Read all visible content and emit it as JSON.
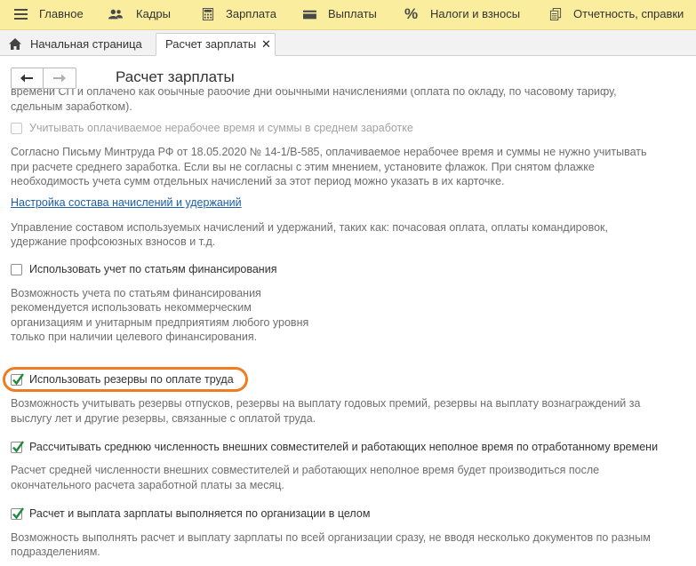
{
  "menu": {
    "items": [
      {
        "label": "Главное",
        "icon": "menu-hamburger-icon"
      },
      {
        "label": "Кадры",
        "icon": "people-icon"
      },
      {
        "label": "Зарплата",
        "icon": "calculator-icon"
      },
      {
        "label": "Выплаты",
        "icon": "wallet-icon"
      },
      {
        "label": "Налоги и взносы",
        "icon": "percent-icon"
      },
      {
        "label": "Отчетность, справки",
        "icon": "documents-icon"
      }
    ]
  },
  "tabs": {
    "home": "Начальная страница",
    "active": "Расчет зарплаты",
    "close_glyph": "✕"
  },
  "page": {
    "title": "Расчет зарплаты"
  },
  "content": {
    "cut_line_1": "времени СП и оплачено как обычные рабочие дни обычными начислениями (оплата по окладу, по часовому тарифу,",
    "cut_line_2": "сдельным заработком).",
    "nonworking_checkbox": {
      "label": "Учитывать оплачиваемое нерабочее время и суммы в среднем заработке",
      "checked": false,
      "disabled": true
    },
    "nonworking_desc": [
      "Согласно Письму Минтруда РФ от 18.05.2020 № 14-1/В-585, оплачиваемое нерабочее время и суммы не нужно учитывать",
      "при расчете среднего заработка. Если вы не согласны с этим мнением, установите флажок. При снятом флажке",
      "необходимость учета сумм отдельных начислений за этот период можно указать в их карточке."
    ],
    "accruals_link": "Настройка состава начислений и удержаний",
    "accruals_desc": [
      "Управление составом используемых начислений и удержаний, таких как: почасовая оплата, оплаты командировок,",
      "удержание профсоюзных взносов и т.д."
    ],
    "financing_checkbox": {
      "label": "Использовать учет по статьям финансирования",
      "checked": false
    },
    "financing_desc": [
      "Возможность учета по статьям финансирования",
      "рекомендуется использовать некоммерческим",
      "организациям и унитарным предприятиям любого уровня",
      "только при наличии целевого финансирования."
    ],
    "reserves_checkbox": {
      "label": "Использовать резервы по оплате труда",
      "checked": true
    },
    "reserves_desc": [
      "Возможность учитывать резервы отпусков,  резервы на выплату годовых премий, резервы на выплату вознаграждений за",
      "выслугу лет и другие резервы, связанные с оплатой труда."
    ],
    "headcount_checkbox": {
      "label": "Рассчитывать среднюю численность внешних совместителей и работающих неполное время по отработанному времени",
      "checked": true
    },
    "headcount_desc": [
      "Расчет средней численности внешних совместителей и работающих неполное время будет производиться после",
      "окончательного расчета заработной платы за месяц."
    ],
    "org_checkbox": {
      "label": "Расчет и выплата зарплаты выполняется по организации в целом",
      "checked": true
    },
    "org_desc": [
      "Возможность выполнять расчет и выплату зарплаты по всей организации сразу, не вводя несколько документов по разным",
      "подразделениям."
    ]
  },
  "colors": {
    "menu_bg": "#fbed9e",
    "checkmark": "#1f8a3a",
    "highlight": "#f07c1f",
    "link": "#1d5ea8"
  }
}
